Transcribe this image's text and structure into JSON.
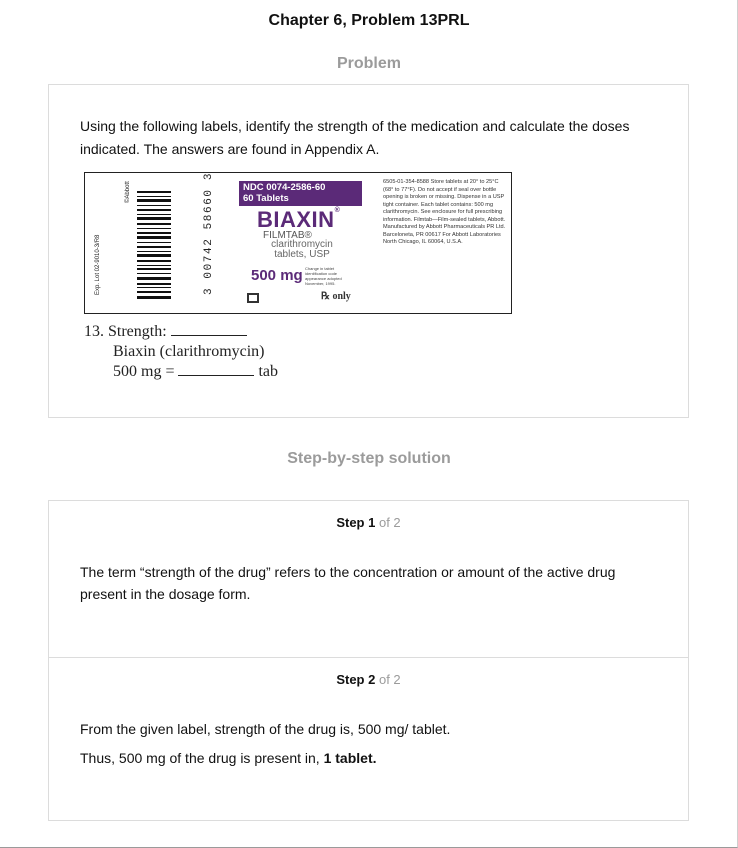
{
  "page_title": "Chapter 6, Problem 13PRL",
  "problem_heading": "Problem",
  "problem_text": "Using the following labels, identify the strength of the medication and calculate the doses indicated. The answers are found in Appendix A.",
  "label": {
    "ndc_line1": "NDC 0074-2586-60",
    "ndc_line2": "60 Tablets",
    "brand": "BIAXIN",
    "brand_mark": "®",
    "filmtab": "FILMTAB®",
    "generic_line1": "clarithromycin",
    "generic_line2": "tablets, USP",
    "dose": "500 mg",
    "tiny_note": "Change in tablet identification code appearance adopted November, 1995.",
    "rx_only": "℞ only",
    "upc_digits": "3 00742 58660 3",
    "lot_text": "Exp. Lot 02-9010-3/R8",
    "abbott_vertical": "©Abbott",
    "right_block": "6505-01-354-8588 Store tablets at 20° to 25°C (68° to 77°F). Do not accept if seal over bottle opening is broken or missing. Dispense in a USP tight container. Each tablet contains: 500 mg clarithromycin. See enclosure for full prescribing information. Filmtab—Film-sealed tablets, Abbott. Manufactured by Abbott Pharmaceuticals PR Ltd. Barceloneta, PR 00617 For Abbott Laboratories North Chicago, IL 60064, U.S.A."
  },
  "question": {
    "number_label": "13. Strength:",
    "drug_line": "Biaxin (clarithromycin)",
    "dose_prefix": "500 mg =",
    "dose_unit": "tab"
  },
  "solution_heading": "Step-by-step solution",
  "steps": [
    {
      "label": "Step 1",
      "of": "of 2",
      "text": "The term “strength of the drug” refers to the concentration or amount of the active drug present in the dosage form."
    },
    {
      "label": "Step 2",
      "of": "of 2",
      "text_line1": "From the given label, strength of the drug is, 500 mg/ tablet.",
      "text_line2_prefix": "Thus, 500 mg of the drug is present in,",
      "text_line2_bold": "1 tablet."
    }
  ]
}
